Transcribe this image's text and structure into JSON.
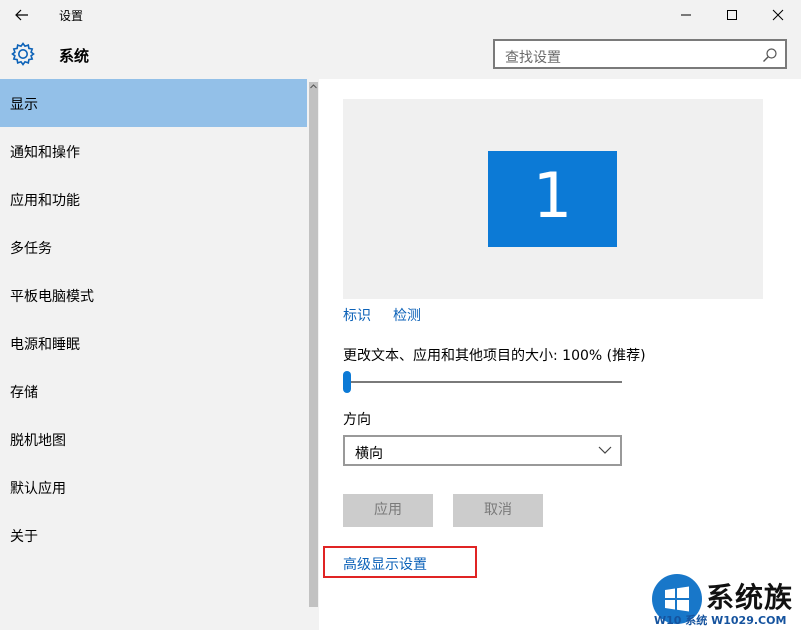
{
  "window": {
    "title": "设置"
  },
  "header": {
    "title": "系统"
  },
  "search": {
    "placeholder": "查找设置"
  },
  "sidebar": {
    "items": [
      {
        "label": "显示",
        "active": true
      },
      {
        "label": "通知和操作"
      },
      {
        "label": "应用和功能"
      },
      {
        "label": "多任务"
      },
      {
        "label": "平板电脑模式"
      },
      {
        "label": "电源和睡眠"
      },
      {
        "label": "存储"
      },
      {
        "label": "脱机地图"
      },
      {
        "label": "默认应用"
      },
      {
        "label": "关于"
      }
    ]
  },
  "display": {
    "monitor_number": "1",
    "identify_link": "标识",
    "detect_link": "检测",
    "scale_label": "更改文本、应用和其他项目的大小: 100% (推荐)",
    "scale_value_percent": 100,
    "orientation_label": "方向",
    "orientation_value": "横向",
    "apply_button": "应用",
    "cancel_button": "取消",
    "advanced_link": "高级显示设置"
  },
  "watermark": {
    "brand": "系统族",
    "url": "W10 系统 W1029.COM"
  },
  "colors": {
    "accent": "#0c7ad6",
    "selected_nav": "#93c0e8",
    "link": "#0c62b8",
    "highlight_box": "#e02424"
  }
}
